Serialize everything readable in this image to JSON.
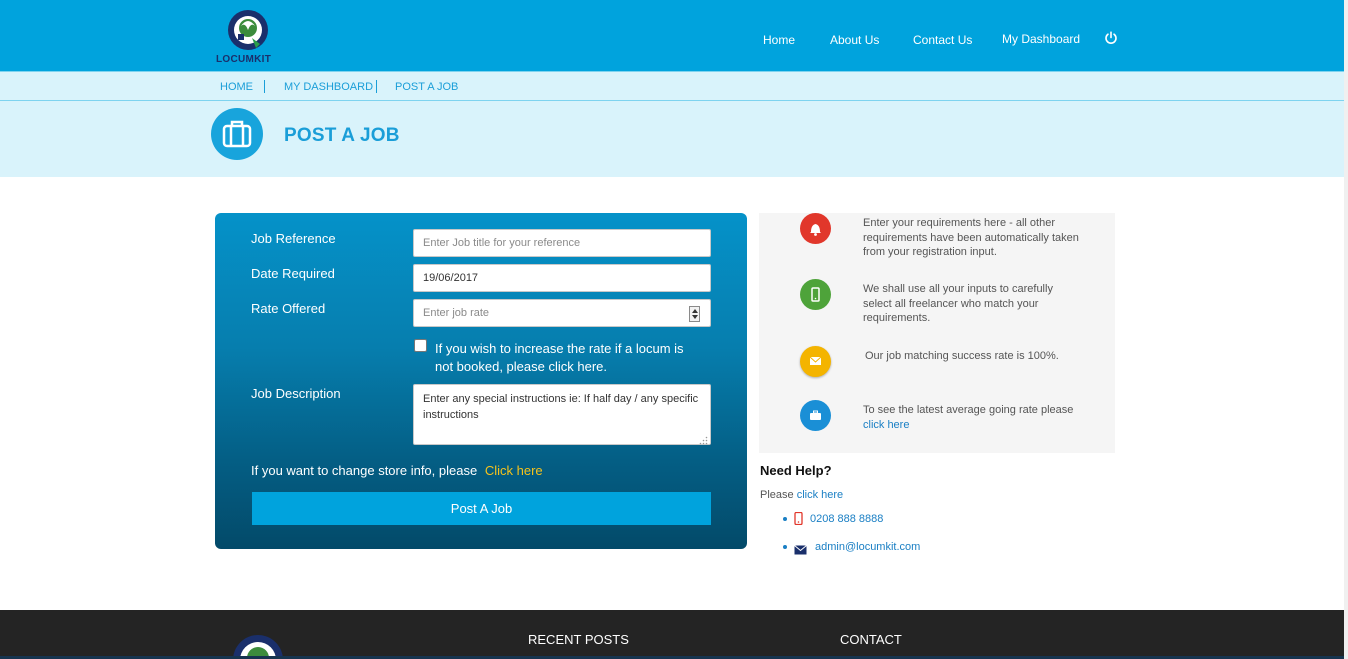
{
  "header": {
    "logo_text": "LOCUMKIT",
    "nav": [
      {
        "label": "Home"
      },
      {
        "label": "About Us"
      },
      {
        "label": "Contact Us"
      },
      {
        "label": "My Dashboard"
      }
    ],
    "power_icon": "power-icon"
  },
  "breadcrumb": {
    "items": [
      {
        "label": "HOME"
      },
      {
        "label": "MY DASHBOARD"
      },
      {
        "label": "POST A JOB"
      }
    ]
  },
  "page": {
    "title": "POST A JOB",
    "title_icon": "briefcase-icon"
  },
  "form": {
    "job_reference_label": "Job Reference",
    "job_reference_placeholder": "Enter Job title for your reference",
    "date_required_label": "Date Required",
    "date_required_value": "19/06/2017",
    "rate_offered_label": "Rate Offered",
    "rate_offered_placeholder": "Enter job rate",
    "increase_rate_checked": false,
    "increase_rate_text": "If you wish to increase the rate if a locum is not booked, please click here.",
    "job_description_label": "Job Description",
    "job_description_placeholder": "Enter any special instructions ie: If half day / any specific instructions",
    "store_info_text": "If you want to change store info, please",
    "store_info_link": "Click here",
    "submit_label": "Post A Job"
  },
  "info": {
    "items": [
      {
        "icon": "bell-icon",
        "color": "#e1372b",
        "text": "Enter your requirements here - all other requirements have been automatically taken from your registration input."
      },
      {
        "icon": "mobile-icon",
        "color": "#4ea33a",
        "text": "We shall use all your inputs to carefully select all freelancer who match your requirements."
      },
      {
        "icon": "envelope-icon",
        "color": "#f4b400",
        "text": "Our job matching success rate is 100%."
      },
      {
        "icon": "briefcase-icon",
        "color": "#1a8fd6",
        "text": "To see the latest average going rate please",
        "link": "click here"
      }
    ]
  },
  "help": {
    "title": "Need Help?",
    "prefix": "Please",
    "link": "click here",
    "phone": "0208 888 8888",
    "email": "admin@locumkit.com"
  },
  "footer": {
    "recent_posts": "RECENT POSTS",
    "contact": "CONTACT"
  },
  "colors": {
    "brand_blue": "#00a3dd",
    "link_yellow": "#f5c21c"
  }
}
